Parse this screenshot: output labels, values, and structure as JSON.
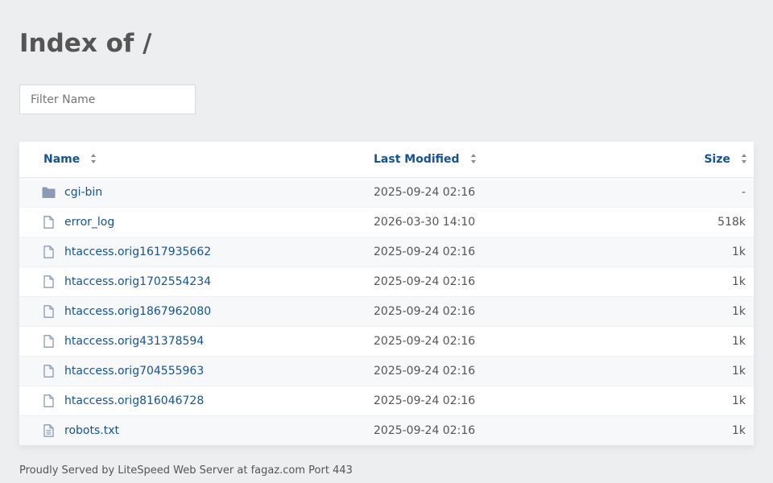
{
  "page": {
    "title": "Index of /"
  },
  "filter": {
    "placeholder": "Filter Name",
    "value": ""
  },
  "table": {
    "headers": {
      "name": "Name",
      "modified": "Last Modified",
      "size": "Size"
    },
    "rows": [
      {
        "name": "cgi-bin",
        "modified": "2025-09-24 02:16",
        "size": "-",
        "icon": "folder-icon"
      },
      {
        "name": "error_log",
        "modified": "2026-03-30 14:10",
        "size": "518k",
        "icon": "file-icon"
      },
      {
        "name": "htaccess.orig1617935662",
        "modified": "2025-09-24 02:16",
        "size": "1k",
        "icon": "file-icon"
      },
      {
        "name": "htaccess.orig1702554234",
        "modified": "2025-09-24 02:16",
        "size": "1k",
        "icon": "file-icon"
      },
      {
        "name": "htaccess.orig1867962080",
        "modified": "2025-09-24 02:16",
        "size": "1k",
        "icon": "file-icon"
      },
      {
        "name": "htaccess.orig431378594",
        "modified": "2025-09-24 02:16",
        "size": "1k",
        "icon": "file-icon"
      },
      {
        "name": "htaccess.orig704555963",
        "modified": "2025-09-24 02:16",
        "size": "1k",
        "icon": "file-icon"
      },
      {
        "name": "htaccess.orig816046728",
        "modified": "2025-09-24 02:16",
        "size": "1k",
        "icon": "file-icon"
      },
      {
        "name": "robots.txt",
        "modified": "2025-09-24 02:16",
        "size": "1k",
        "icon": "text-file-icon"
      }
    ]
  },
  "footer": {
    "text": "Proudly Served by LiteSpeed Web Server at fagaz.com Port 443"
  },
  "colors": {
    "link": "#11539c",
    "background": "#eceef0",
    "icon": "#8a9bb5"
  }
}
